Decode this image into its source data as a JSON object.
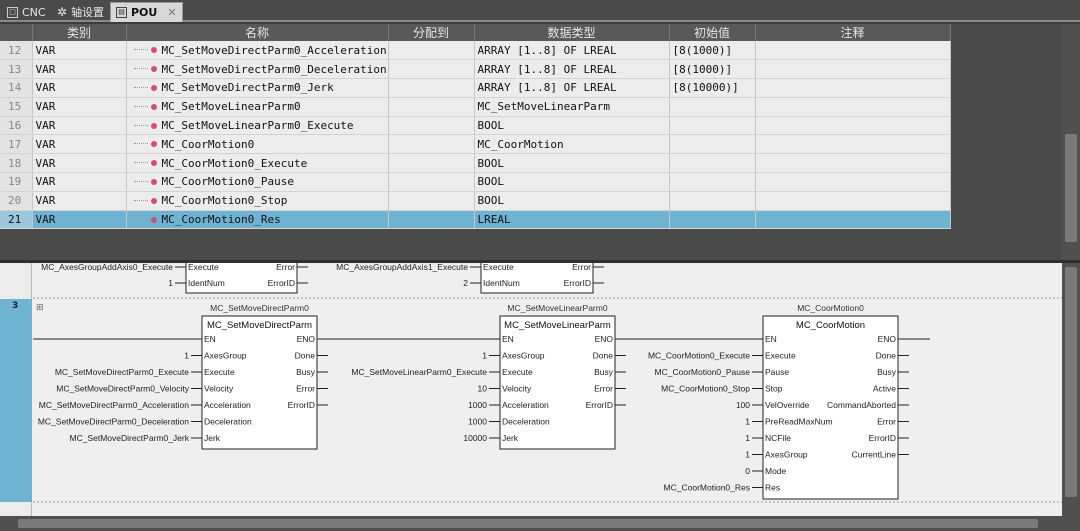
{
  "tabs": [
    {
      "label": "CNC",
      "icon": "cnc-icon"
    },
    {
      "label": "轴设置",
      "icon": "gear-icon"
    },
    {
      "label": "POU",
      "icon": "pou-icon",
      "active": true
    }
  ],
  "table": {
    "columns": [
      "类别",
      "名称",
      "分配到",
      "数据类型",
      "初始值",
      "注释"
    ],
    "rows": [
      {
        "no": "12",
        "cat": "VAR",
        "name": "MC_SetMoveDirectParm0_Acceleration",
        "assign": "",
        "type": "ARRAY [1..8] OF LREAL",
        "init": "[8(1000)]",
        "comment": ""
      },
      {
        "no": "13",
        "cat": "VAR",
        "name": "MC_SetMoveDirectParm0_Deceleration",
        "assign": "",
        "type": "ARRAY [1..8] OF LREAL",
        "init": "[8(1000)]",
        "comment": ""
      },
      {
        "no": "14",
        "cat": "VAR",
        "name": "MC_SetMoveDirectParm0_Jerk",
        "assign": "",
        "type": "ARRAY [1..8] OF LREAL",
        "init": "[8(10000)]",
        "comment": ""
      },
      {
        "no": "15",
        "cat": "VAR",
        "name": "MC_SetMoveLinearParm0",
        "assign": "",
        "type": "MC_SetMoveLinearParm",
        "init": "",
        "comment": ""
      },
      {
        "no": "16",
        "cat": "VAR",
        "name": "MC_SetMoveLinearParm0_Execute",
        "assign": "",
        "type": "BOOL",
        "init": "",
        "comment": ""
      },
      {
        "no": "17",
        "cat": "VAR",
        "name": "MC_CoorMotion0",
        "assign": "",
        "type": "MC_CoorMotion",
        "init": "",
        "comment": ""
      },
      {
        "no": "18",
        "cat": "VAR",
        "name": "MC_CoorMotion0_Execute",
        "assign": "",
        "type": "BOOL",
        "init": "",
        "comment": ""
      },
      {
        "no": "19",
        "cat": "VAR",
        "name": "MC_CoorMotion0_Pause",
        "assign": "",
        "type": "BOOL",
        "init": "",
        "comment": ""
      },
      {
        "no": "20",
        "cat": "VAR",
        "name": "MC_CoorMotion0_Stop",
        "assign": "",
        "type": "BOOL",
        "init": "",
        "comment": ""
      },
      {
        "no": "21",
        "cat": "VAR",
        "name": "MC_CoorMotion0_Res",
        "assign": "",
        "type": "LREAL",
        "init": "",
        "comment": "",
        "selected": true
      }
    ]
  },
  "ladder": {
    "rung_number": "3",
    "prev_rung": {
      "block1": {
        "inputs": [
          {
            "var": "MC_AxesGroupAddAxis0_Execute",
            "pin": "Execute"
          },
          {
            "var": "1",
            "pin": "IdentNum"
          }
        ],
        "outputs": [
          "Error",
          "ErrorID"
        ]
      },
      "block2": {
        "inputs": [
          {
            "var": "MC_AxesGroupAddAxis1_Execute",
            "pin": "Execute"
          },
          {
            "var": "2",
            "pin": "IdentNum"
          }
        ],
        "outputs": [
          "Error",
          "ErrorID"
        ]
      }
    },
    "blocks": [
      {
        "instance": "MC_SetMoveDirectParm0",
        "type": "MC_SetMoveDirectParm",
        "inputs": [
          {
            "var": "",
            "pin": "EN"
          },
          {
            "var": "1",
            "pin": "AxesGroup"
          },
          {
            "var": "MC_SetMoveDirectParm0_Execute",
            "pin": "Execute"
          },
          {
            "var": "MC_SetMoveDirectParm0_Velocity",
            "pin": "Velocity"
          },
          {
            "var": "MC_SetMoveDirectParm0_Acceleration",
            "pin": "Acceleration"
          },
          {
            "var": "MC_SetMoveDirectParm0_Deceleration",
            "pin": "Deceleration"
          },
          {
            "var": "MC_SetMoveDirectParm0_Jerk",
            "pin": "Jerk"
          }
        ],
        "outputs": [
          "ENO",
          "Done",
          "Busy",
          "Error",
          "ErrorID"
        ]
      },
      {
        "instance": "MC_SetMoveLinearParm0",
        "type": "MC_SetMoveLinearParm",
        "inputs": [
          {
            "var": "",
            "pin": "EN"
          },
          {
            "var": "1",
            "pin": "AxesGroup"
          },
          {
            "var": "MC_SetMoveLinearParm0_Execute",
            "pin": "Execute"
          },
          {
            "var": "10",
            "pin": "Velocity"
          },
          {
            "var": "1000",
            "pin": "Acceleration"
          },
          {
            "var": "1000",
            "pin": "Deceleration"
          },
          {
            "var": "10000",
            "pin": "Jerk"
          }
        ],
        "outputs": [
          "ENO",
          "Done",
          "Busy",
          "Error",
          "ErrorID"
        ]
      },
      {
        "instance": "MC_CoorMotion0",
        "type": "MC_CoorMotion",
        "inputs": [
          {
            "var": "",
            "pin": "EN"
          },
          {
            "var": "MC_CoorMotion0_Execute",
            "pin": "Execute"
          },
          {
            "var": "MC_CoorMotion0_Pause",
            "pin": "Pause"
          },
          {
            "var": "MC_CoorMotion0_Stop",
            "pin": "Stop"
          },
          {
            "var": "100",
            "pin": "VelOverride"
          },
          {
            "var": "1",
            "pin": "PreReadMaxNum"
          },
          {
            "var": "1",
            "pin": "NCFile"
          },
          {
            "var": "1",
            "pin": "AxesGroup"
          },
          {
            "var": "0",
            "pin": "Mode"
          },
          {
            "var": "MC_CoorMotion0_Res",
            "pin": "Res"
          }
        ],
        "outputs": [
          "ENO",
          "Done",
          "Busy",
          "Active",
          "CommandAborted",
          "Error",
          "ErrorID",
          "CurrentLine"
        ]
      }
    ]
  }
}
